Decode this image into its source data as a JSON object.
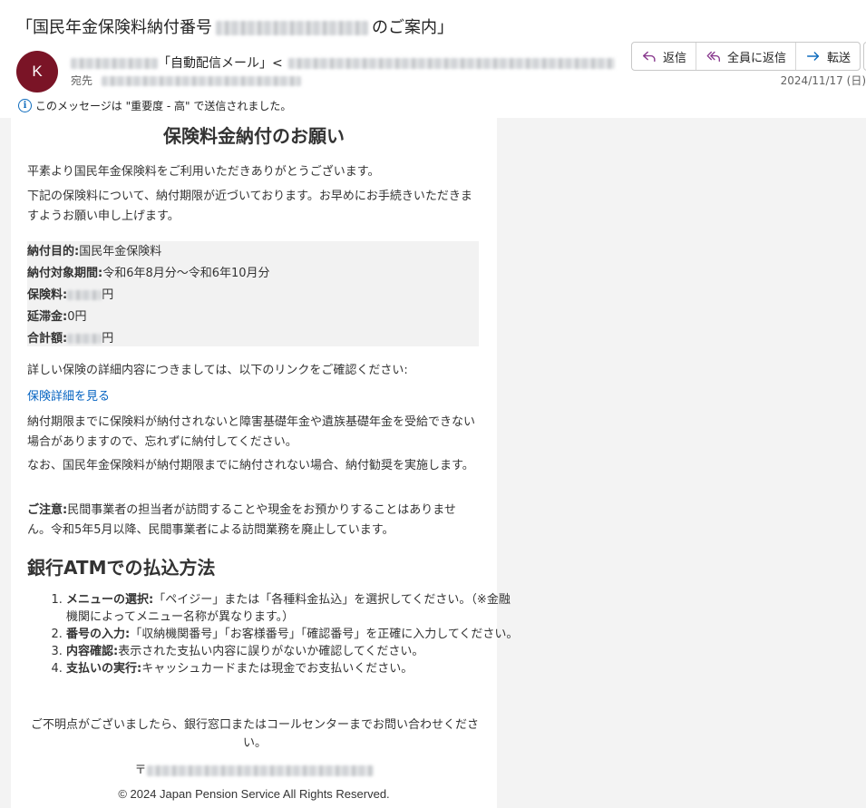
{
  "header": {
    "subject_prefix": "「国民年金保険料納付番号",
    "subject_suffix": "のご案内」",
    "avatar_initial": "K",
    "sender_tag": "「自動配信メール」<",
    "to_label": "宛先",
    "date": "2024/11/17 (日)",
    "importance_text": "このメッセージは \"重要度 - 高\" で送信されました。"
  },
  "actions": {
    "reply": "返信",
    "reply_all": "全員に返信",
    "forward": "転送"
  },
  "email": {
    "title": "保険料金納付のお願い",
    "greeting": "平素より国民年金保険料をご利用いただきありがとうございます。",
    "intro": "下記の保険料について、納付期限が近づいております。お早めにお手続きいただきますようお願い申し上げます。",
    "details": {
      "purpose_label": "納付目的:",
      "purpose_value": "国民年金保険料",
      "period_label": "納付対象期間:",
      "period_value": "令和6年8月分～令和6年10月分",
      "premium_label": "保険料:",
      "premium_suffix": "円",
      "late_label": "延滞金:",
      "late_value": "0円",
      "total_label": "合計額:",
      "total_suffix": "円"
    },
    "detail_prompt": "詳しい保険の詳細内容につきましては、以下のリンクをご確認ください:",
    "detail_link": "保険詳細を見る",
    "warning": "納付期限までに保険料が納付されないと障害基礎年金や遺族基礎年金を受給できない場合がありますので、忘れずに納付してください。",
    "notice": "なお、国民年金保険料が納付期限までに納付されない場合、納付勧奨を実施します。",
    "caution_label": "ご注意:",
    "caution_text": "民間事業者の担当者が訪問することや現金をお預かりすることはありません。令和5年5月以降、民間事業者による訪問業務を廃止しています。",
    "atm_heading": "銀行ATMでの払込方法",
    "steps": [
      {
        "label": "メニューの選択:",
        "text": "「ペイジー」または「各種料金払込」を選択してください。（※金融機関によってメニュー名称が異なります。）"
      },
      {
        "label": "番号の入力:",
        "text": "「収納機関番号」「お客様番号」「確認番号」を正確に入力してください。"
      },
      {
        "label": "内容確認:",
        "text": "表示された支払い内容に誤りがないか確認してください。"
      },
      {
        "label": "支払いの実行:",
        "text": "キャッシュカードまたは現金でお支払いください。"
      }
    ],
    "contact": "ご不明点がございましたら、銀行窓口またはコールセンターまでお問い合わせください。",
    "postal_mark": "〒",
    "copyright": "© 2024 Japan Pension Service All Rights Reserved."
  }
}
